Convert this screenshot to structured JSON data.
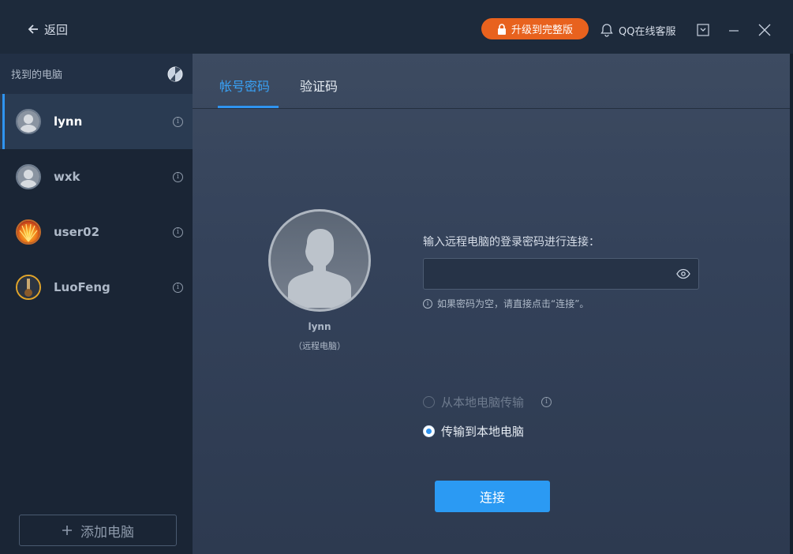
{
  "titlebar": {
    "back_label": "返回",
    "upgrade_label": "升级到完整版",
    "qq_label": "QQ在线客服"
  },
  "sidebar": {
    "header": "找到的电脑",
    "devices": [
      {
        "name": "lynn",
        "avatar": "default-user",
        "active": true
      },
      {
        "name": "wxk",
        "avatar": "default-user",
        "active": false
      },
      {
        "name": "user02",
        "avatar": "flower",
        "active": false
      },
      {
        "name": "LuoFeng",
        "avatar": "guitar",
        "active": false
      }
    ],
    "add_label": "添加电脑"
  },
  "main": {
    "tabs": [
      {
        "label": "帐号密码",
        "active": true
      },
      {
        "label": "验证码",
        "active": false
      }
    ],
    "remote": {
      "name": "lynn",
      "subtitle": "（远程电脑）"
    },
    "prompt": "输入远程电脑的登录密码进行连接：",
    "password": {
      "value": "",
      "placeholder": ""
    },
    "hint": "如果密码为空，请直接点击“连接”。",
    "options": [
      {
        "label": "从本地电脑传输",
        "selected": false,
        "disabled": true
      },
      {
        "label": "传输到本地电脑",
        "selected": true,
        "disabled": false
      }
    ],
    "connect_label": "连接"
  },
  "colors": {
    "accent": "#2f94f0",
    "upgrade": "#e8621e",
    "sidebar_bg": "#1a2535",
    "main_bg": "#34425a"
  }
}
